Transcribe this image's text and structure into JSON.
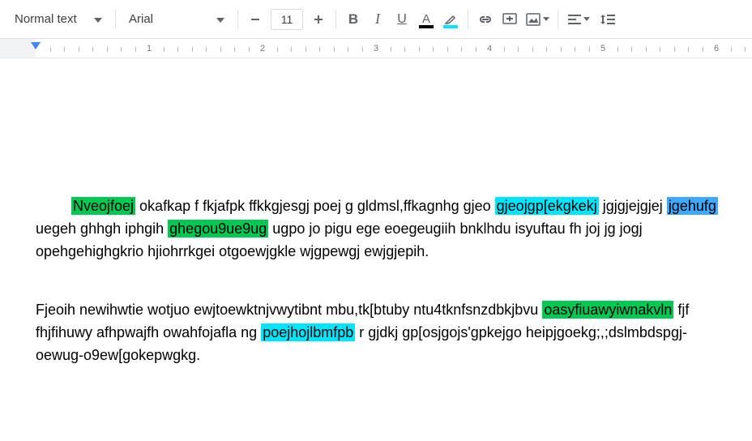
{
  "toolbar": {
    "style": "Normal text",
    "font": "Arial",
    "font_size": "11",
    "text_color": "#000000",
    "highlight_color": "#00e5ff"
  },
  "ruler": {
    "numbers": [
      "1",
      "2",
      "3",
      "4",
      "5",
      "6"
    ]
  },
  "doc": {
    "p1": {
      "s1": "Nveojfoej",
      "s2": "  okafkap f fkjafpk ffkkgjesgj poej g gldmsl,ffkagnhg gjeo ",
      "s3": "gjeojgp[ekgkekj",
      "s4": " jgjgjejgjej ",
      "s5": "jgehufg",
      "s6": " uegeh ghhgh iphgih ",
      "s7": "ghegou9ue9ug",
      "s8": " ugpo jo pigu ege  eoegeugiih bnklhdu isyuftau fh joj jg  jogj opehgehighgkrio hjiohrrkgei otgoewjgkle wjgpewgj ewjgjepih."
    },
    "p2": {
      "s1": "Fjeoih newihwtie wotjuo ewjtoewktnjvwytibnt  mbu,tk[btuby ntu4tknfsnzdbkjbvu ",
      "s2": "oasyfiuawyiwnakvln",
      "s3": " fjf fhjfihuwy  afhpwajfh owahfojafla ng ",
      "s4": "poejhojlbmfpb",
      "s5": " r gjdkj gp[osjgojs'gpkejgo heipjgoekg;,;dslmbdspgj-oewug-o9ew[gokepwgkg."
    }
  }
}
